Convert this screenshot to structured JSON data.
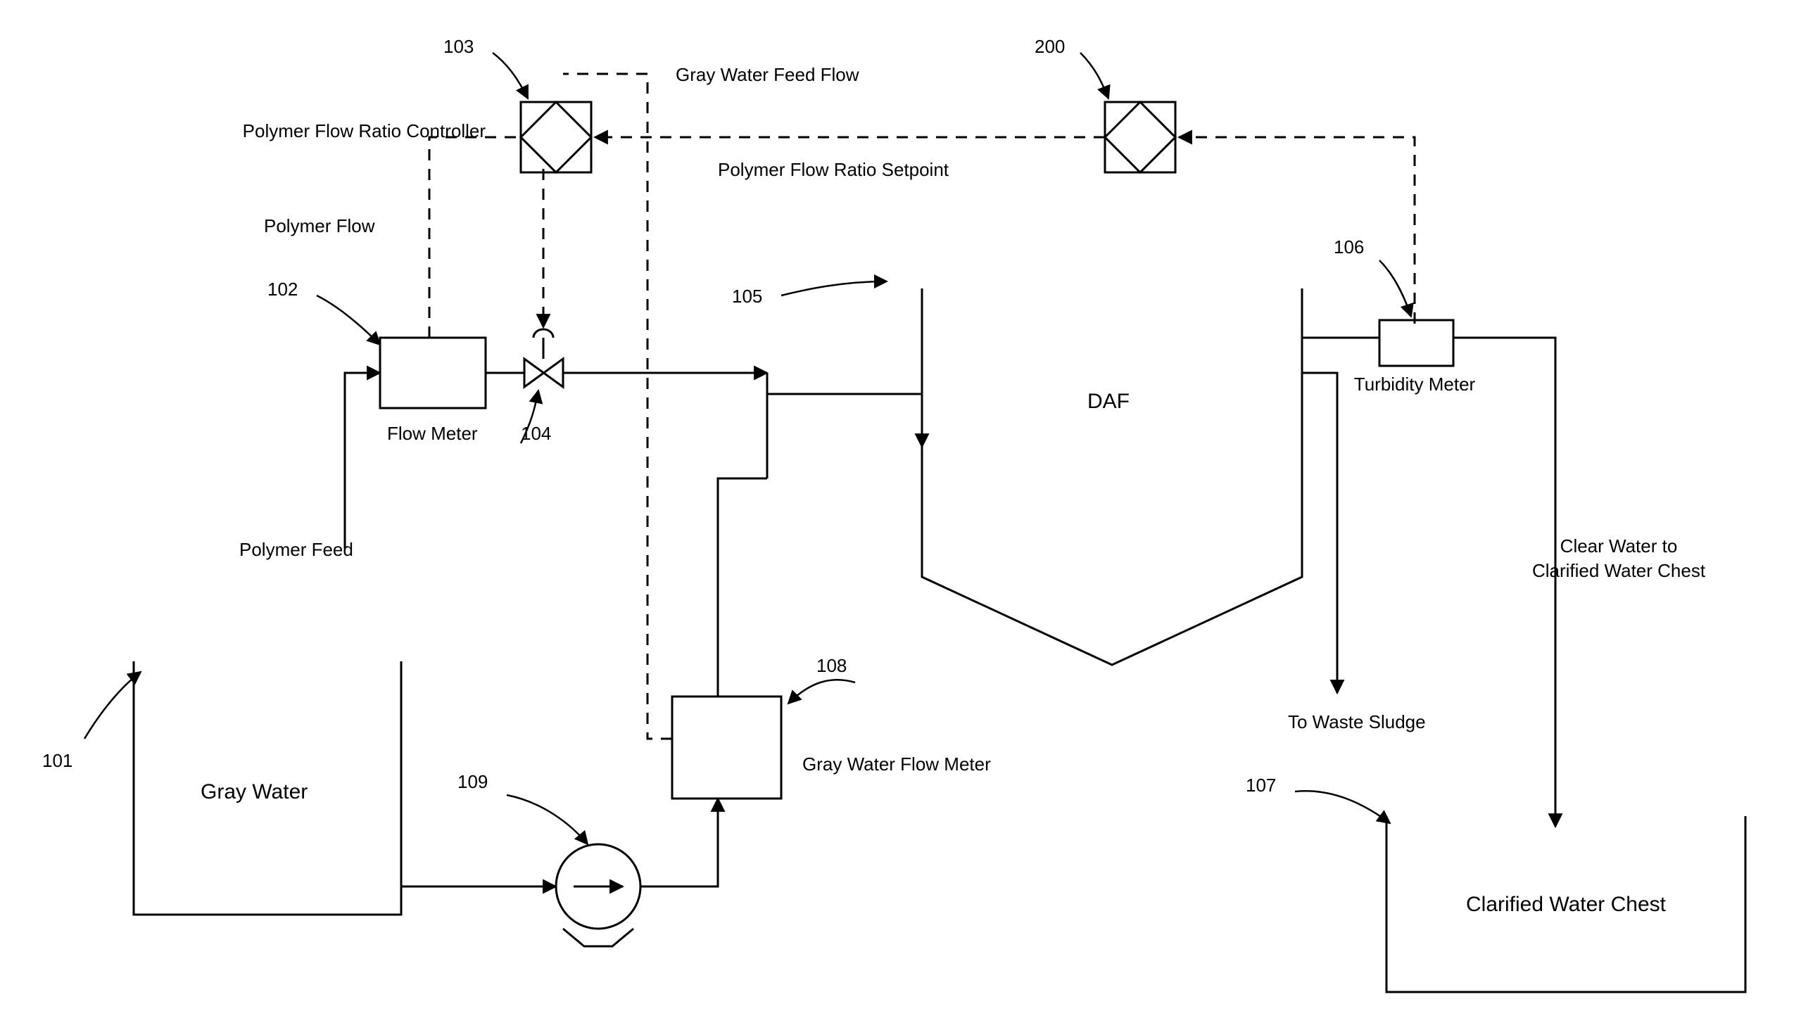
{
  "labels": {
    "grayWaterTank": "Gray Water",
    "polymerFeed": "Polymer Feed",
    "flowMeter": "Flow Meter",
    "polymerFlowRatioController": "Polymer Flow Ratio Controller",
    "polymerFlow": "Polymer Flow",
    "grayWaterFeedFlow": "Gray Water Feed Flow",
    "polymerFlowRatioSetpoint": "Polymer Flow Ratio Setpoint",
    "daf": "DAF",
    "grayWaterFlowMeter": "Gray Water Flow Meter",
    "toWasteSludge": "To Waste Sludge",
    "turbidityMeter": "Turbidity Meter",
    "clearWaterLine1": "Clear Water to",
    "clearWaterLine2": "Clarified Water Chest",
    "clarifiedWaterChest": "Clarified Water Chest"
  },
  "refs": {
    "r101": "101",
    "r102": "102",
    "r103": "103",
    "r104": "104",
    "r105": "105",
    "r106": "106",
    "r107": "107",
    "r108": "108",
    "r109": "109",
    "r200": "200"
  }
}
